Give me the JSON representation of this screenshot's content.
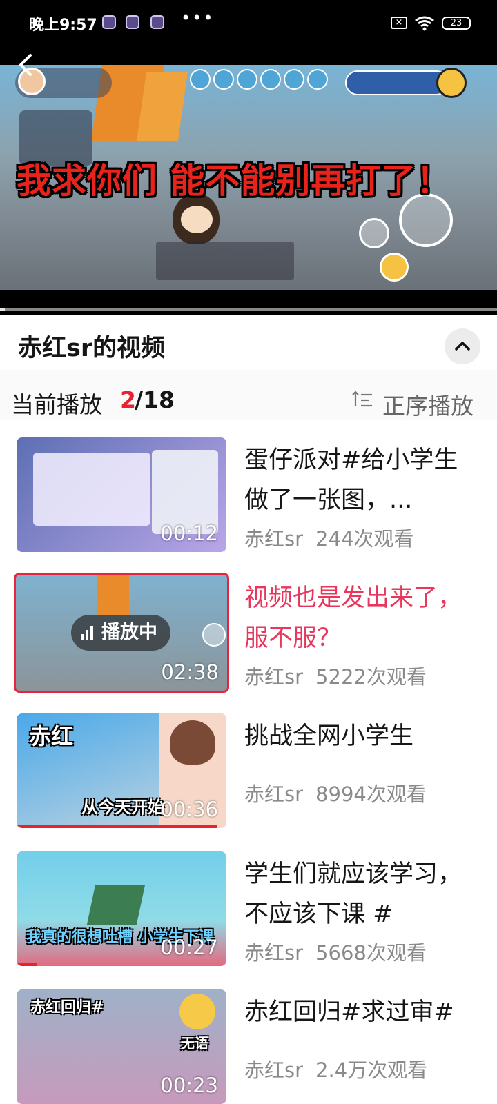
{
  "status_bar": {
    "time": "晚上9:57",
    "battery": "23"
  },
  "video": {
    "caption": "我求你们 能不能别再打了！",
    "progress_fraction": 0.01
  },
  "panel": {
    "title": "赤红sr的视频",
    "now_playing_label": "当前播放",
    "current_index": "2",
    "total": "/18",
    "order_label": "正序播放"
  },
  "videos": [
    {
      "title": "蛋仔派对#给小学生做了一张图，...",
      "author": "赤红sr",
      "views": "244次观看",
      "duration": "00:12",
      "thumb_colors": [
        "#5d6fb3",
        "#b9a6e8"
      ],
      "thumb_text": ""
    },
    {
      "title": "视频也是发出来了，服不服？",
      "author": "赤红sr",
      "views": "5222次观看",
      "duration": "02:38",
      "playing_label": "播放中",
      "thumb_colors": [
        "#7fb2cf",
        "#8b949a"
      ],
      "thumb_text": ""
    },
    {
      "title": "挑战全网小学生",
      "author": "赤红sr",
      "views": "8994次观看",
      "duration": "00:36",
      "thumb_colors": [
        "#4aa9e9",
        "#c8d7df"
      ],
      "thumb_text": "赤红",
      "thumb_subtitle": "从今天开始"
    },
    {
      "title": "学生们就应该学习，不应该下课 #",
      "author": "赤红sr",
      "views": "5668次观看",
      "duration": "00:27",
      "thumb_colors": [
        "#73cfe9",
        "#e46a80"
      ],
      "thumb_text": "",
      "thumb_subtitle": "我真的很想吐槽 小学生下课"
    },
    {
      "title": "赤红回归#求过审#",
      "author": "赤红sr",
      "views": "2.4万次观看",
      "duration": "00:23",
      "thumb_colors": [
        "#9fb1c8",
        "#c79abc"
      ],
      "thumb_text": "赤红回归#",
      "thumb_subtitle": "无语"
    }
  ]
}
